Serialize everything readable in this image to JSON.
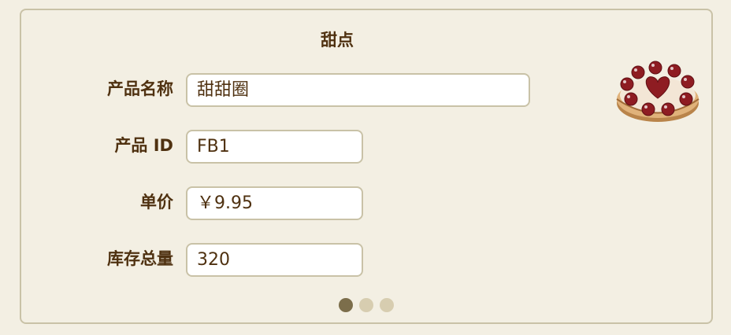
{
  "card": {
    "title": "甜点"
  },
  "form": {
    "name_label": "产品名称",
    "name_value": "甜甜圈",
    "id_label": "产品 ID",
    "id_value": "FB1",
    "price_label": "单价",
    "price_value": "￥9.95",
    "stock_label": "库存总量",
    "stock_value": "320"
  },
  "image": {
    "icon": "cherry-tart-icon"
  },
  "pager": {
    "pages": 3,
    "current": 1
  },
  "colors": {
    "background": "#f3efe3",
    "text": "#4f3110",
    "border": "#c9c2a7",
    "field_bg": "#ffffff",
    "dot_active": "#7c6e4b",
    "dot_inactive": "#d7cdb0"
  }
}
